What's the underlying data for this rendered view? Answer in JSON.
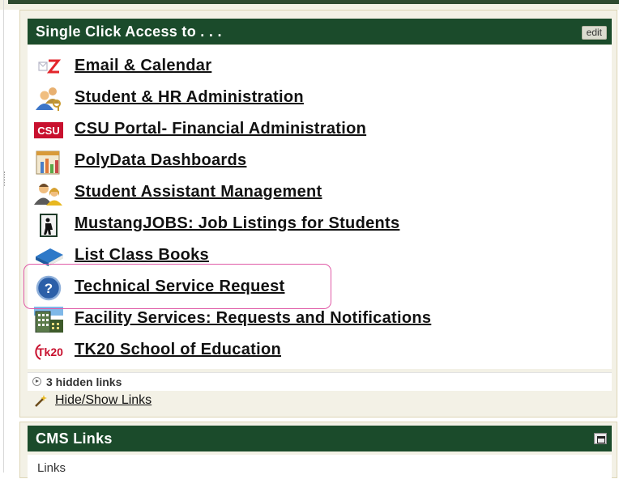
{
  "portlet_single_click": {
    "title": "Single Click Access to . . .",
    "edit_label": "edit",
    "links": [
      {
        "label": "Email & Calendar",
        "icon": "email-icon"
      },
      {
        "label": "Student & HR Administration",
        "icon": "people-icon"
      },
      {
        "label": "CSU Portal- Financial Administration",
        "icon": "csu-logo-icon",
        "icon_text": "CSU"
      },
      {
        "label": "PolyData Dashboards",
        "icon": "dashboard-chart-icon"
      },
      {
        "label": "Student Assistant Management",
        "icon": "student-assistant-icon"
      },
      {
        "label": "MustangJOBS: Job Listings for Students",
        "icon": "jobs-door-icon"
      },
      {
        "label": "List Class Books",
        "icon": "book-icon"
      },
      {
        "label": "Technical Service Request",
        "icon": "help-question-icon"
      },
      {
        "label": "Facility Services: Requests and Notifications",
        "icon": "building-icon"
      },
      {
        "label": "TK20 School of Education",
        "icon": "tk20-logo-icon",
        "icon_text": "Tk20"
      }
    ],
    "hidden_links_label": "3 hidden links",
    "hide_show_label": "Hide/Show Links"
  },
  "portlet_cms": {
    "title": "CMS Links",
    "body_text": "Links"
  },
  "colors": {
    "titlebar": "#1b4b2b",
    "portlet_bg": "#f3f1e6",
    "highlight": "#e05aa6"
  }
}
